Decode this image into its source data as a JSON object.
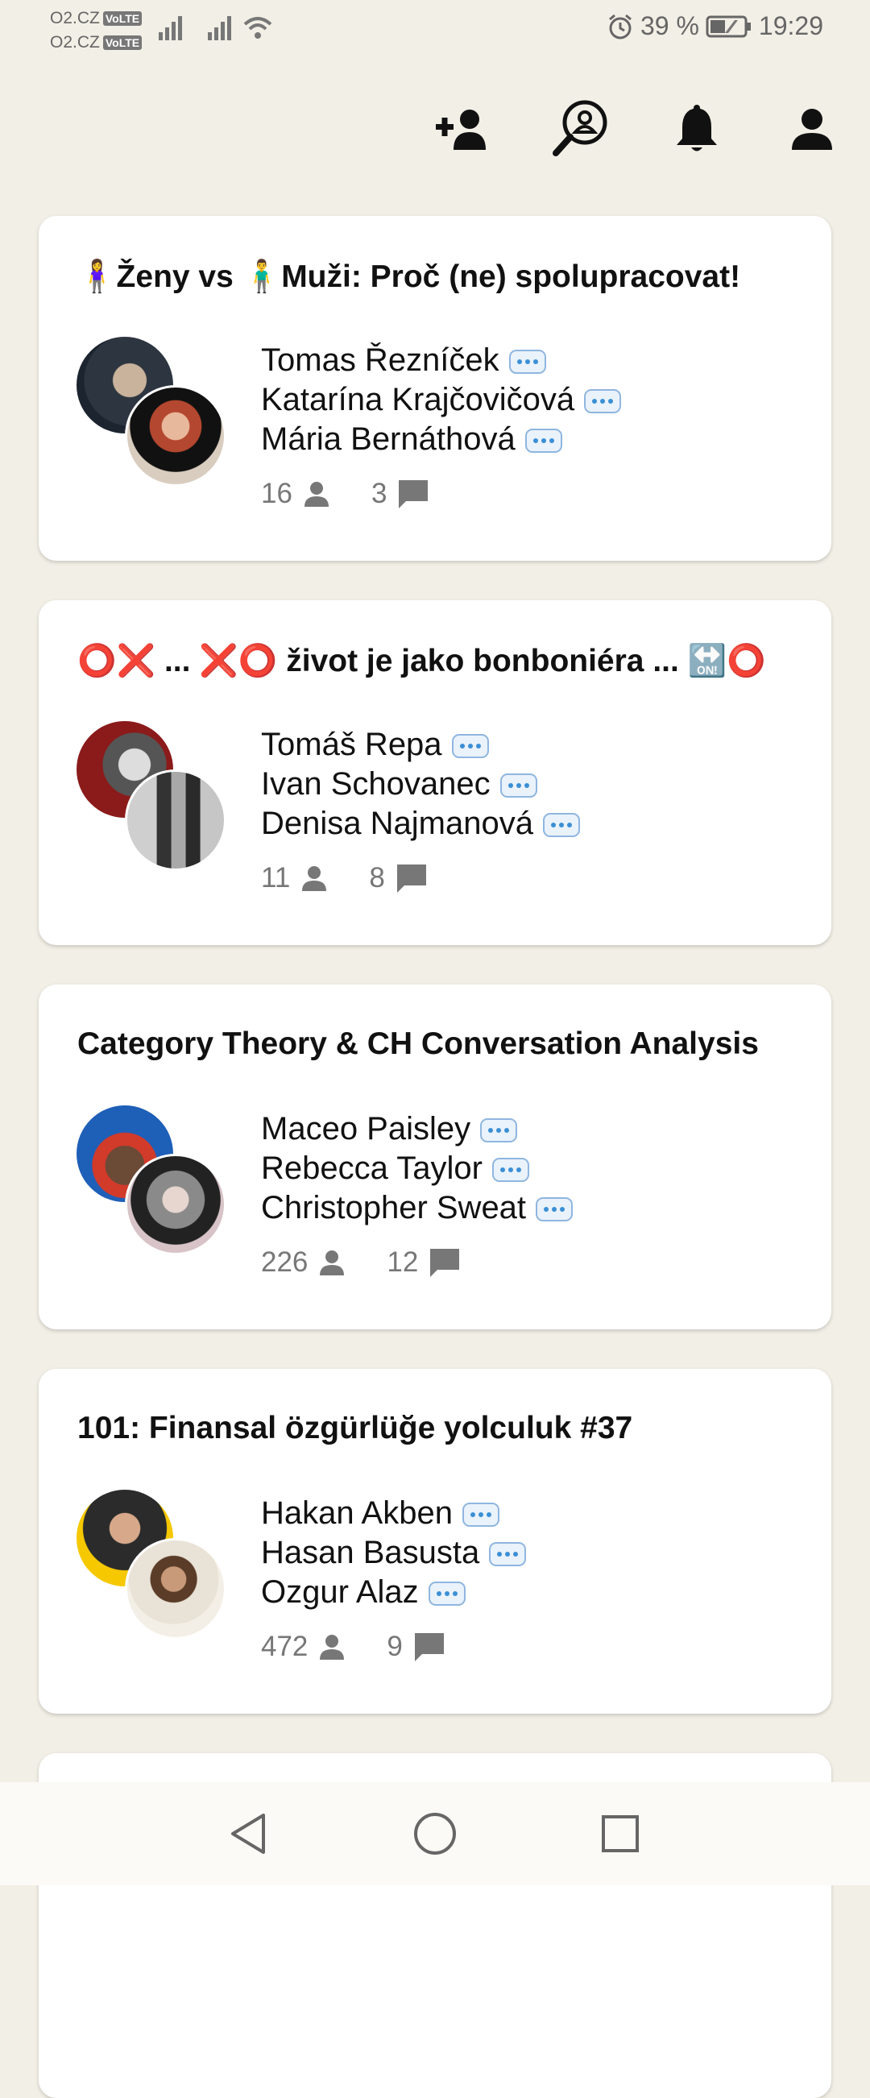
{
  "status_bar": {
    "carrier1": "O2.CZ",
    "carrier2": "O2.CZ",
    "volte": "VoLTE",
    "battery": "39 %",
    "time": "19:29"
  },
  "toolbar_icons": [
    "add-person-icon",
    "search-people-icon",
    "bell-icon",
    "profile-icon"
  ],
  "rooms": [
    {
      "title": "🧍‍♀️Ženy vs 🧍‍♂️Muži: Proč (ne) spolupracovat!",
      "speakers": [
        "Tomas Řezníček",
        "Katarína Krajčovičová",
        "Mária Bernáthová"
      ],
      "listeners": "16",
      "comments": "3"
    },
    {
      "title": "⭕❌ ... ❌⭕ život je jako bonboniéra ... 🔛⭕",
      "speakers": [
        "Tomáš Repa",
        "Ivan Schovanec",
        "Denisa Najmanová"
      ],
      "listeners": "11",
      "comments": "8"
    },
    {
      "title": "Category Theory & CH Conversation Analysis",
      "speakers": [
        "Maceo Paisley",
        "Rebecca Taylor",
        "Christopher Sweat"
      ],
      "listeners": "226",
      "comments": "12"
    },
    {
      "title": "101: Finansal özgürlüğe yolculuk #37",
      "speakers": [
        "Hakan Akben",
        "Hasan Basusta",
        "Ozgur Alaz"
      ],
      "listeners": "472",
      "comments": "9"
    }
  ],
  "colors": {
    "background": "#f2efe6",
    "card": "#ffffff",
    "bubble": "#3b8fd6",
    "muted": "#777777"
  }
}
